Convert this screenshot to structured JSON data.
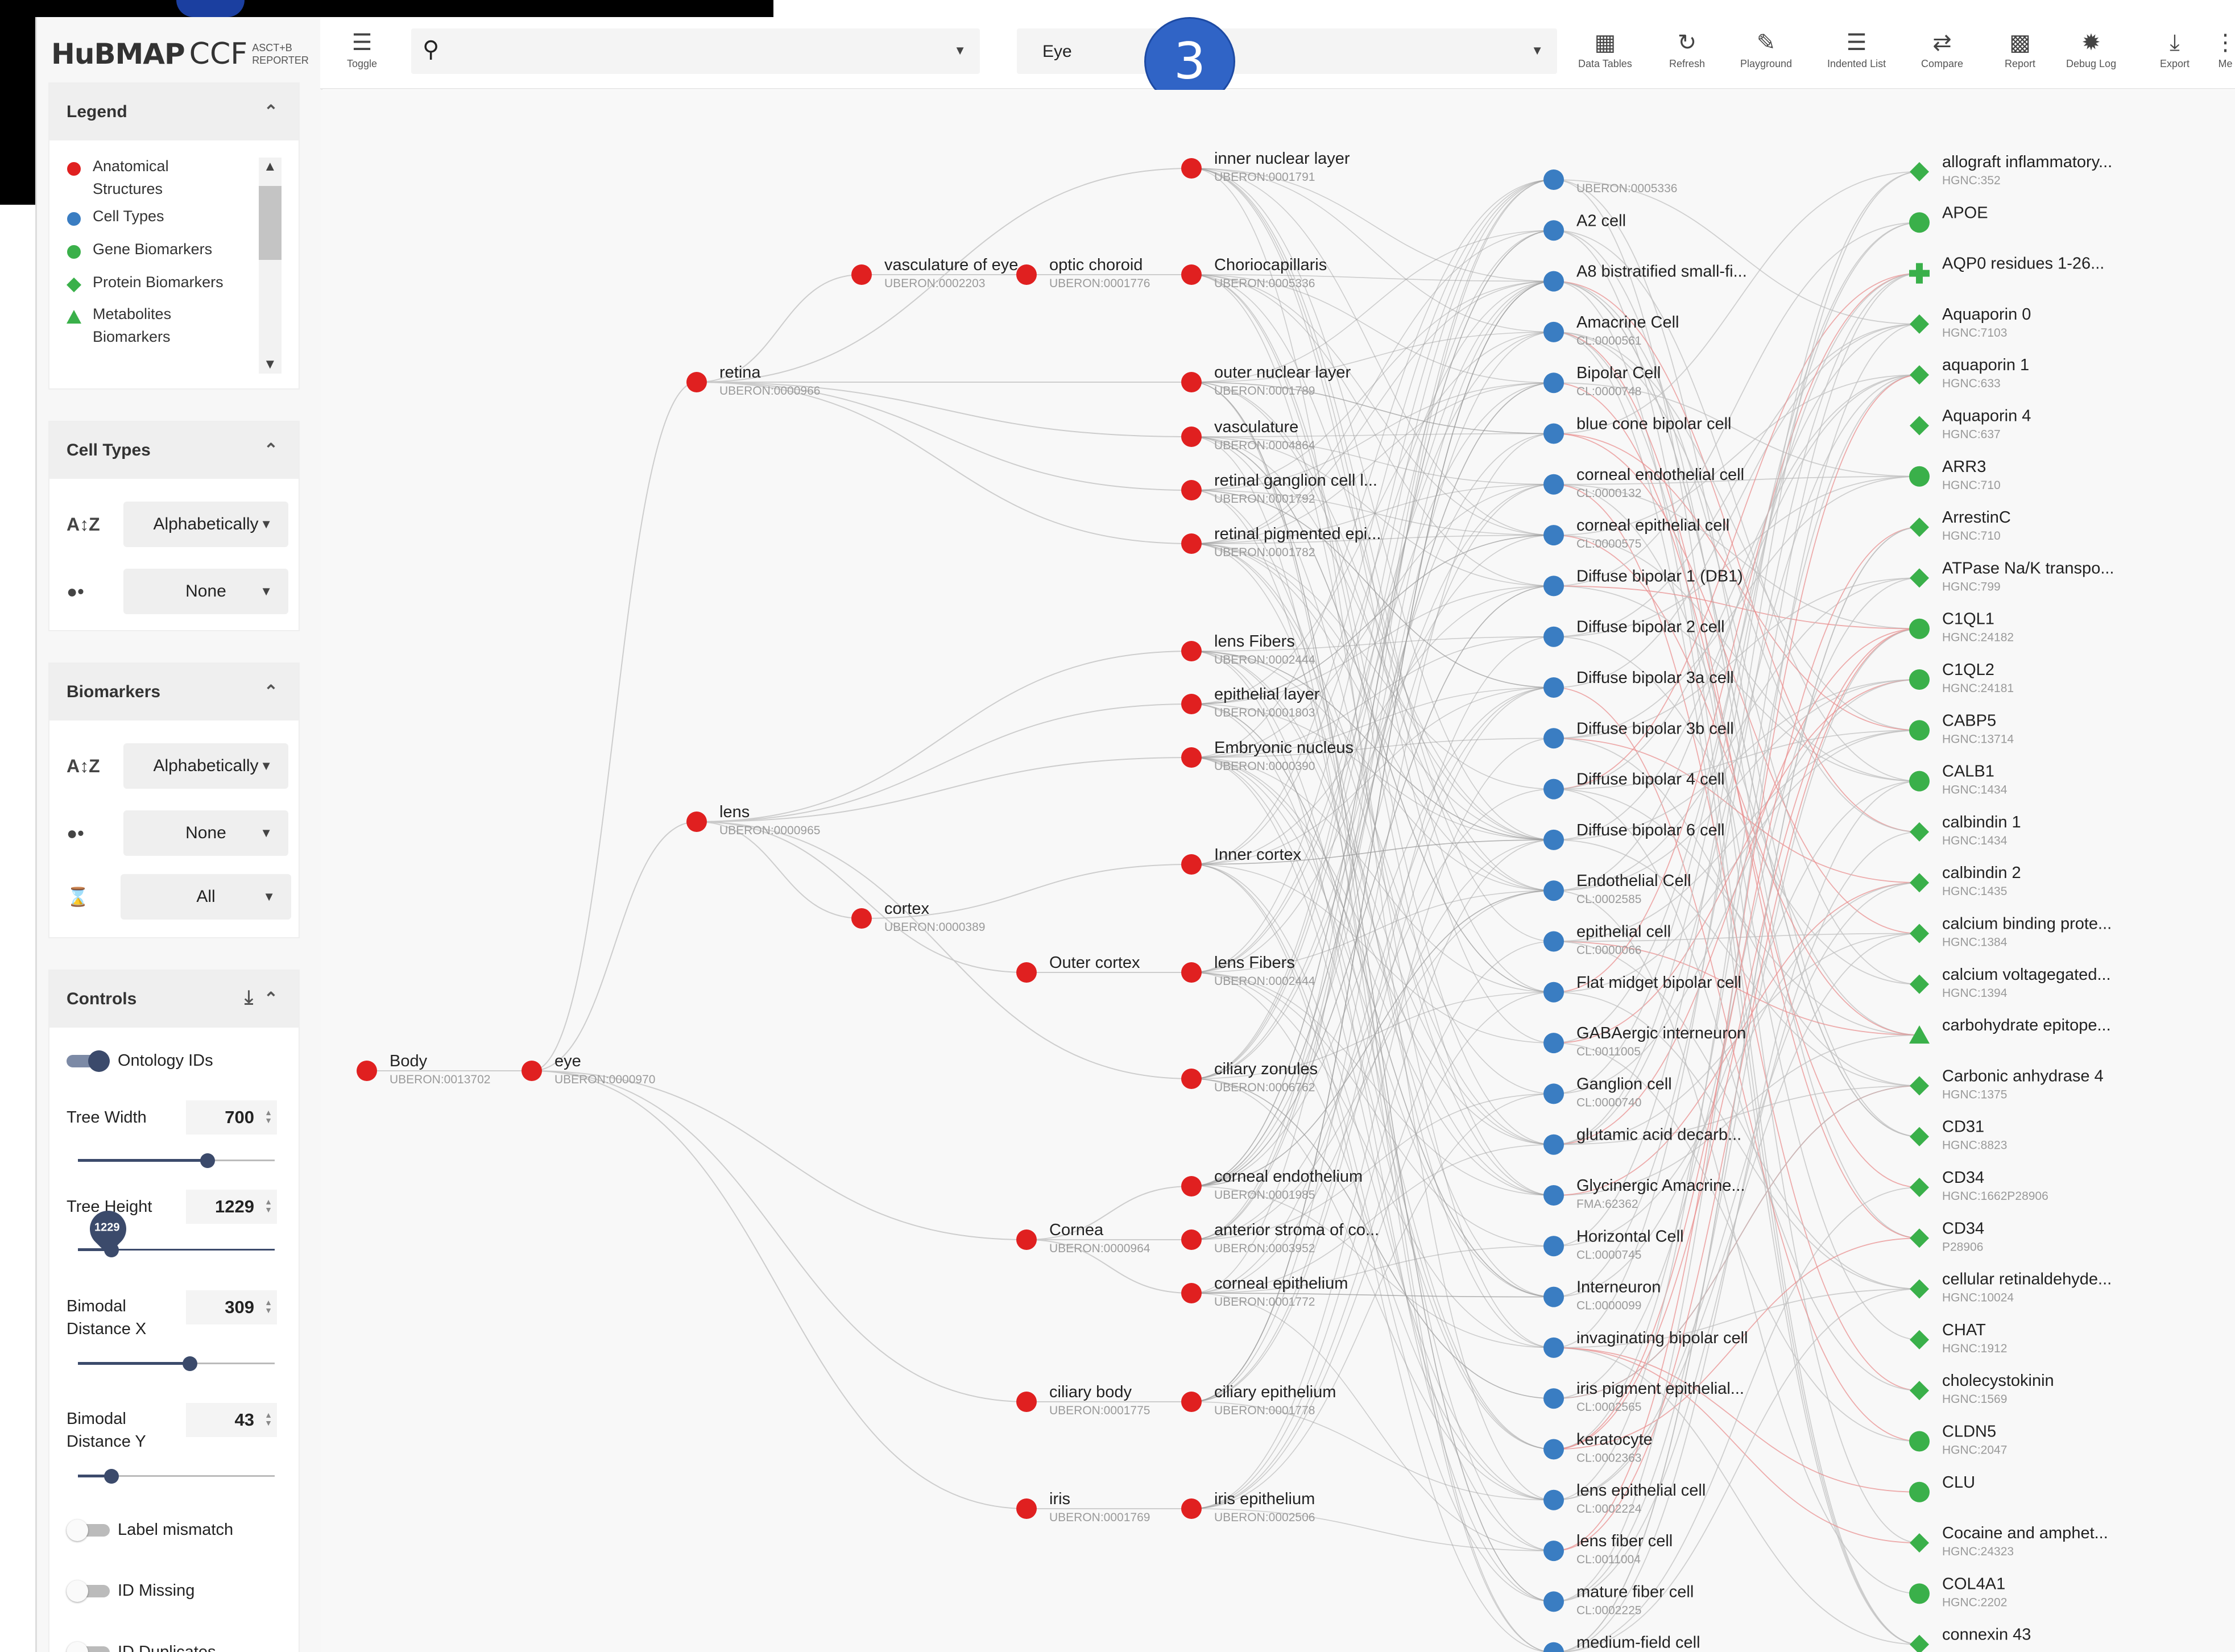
{
  "app": {
    "logo_hubmap": "HuBMAP",
    "logo_ccf": "CCF",
    "logo_sub1": "ASCT+B",
    "logo_sub2": "REPORTER",
    "step_number": "3"
  },
  "colors": {
    "anatomical": "#e02020",
    "cell": "#3a7dc2",
    "gene": "#3ab04a",
    "protein": "#3ab04a",
    "metabolite": "#3ab04a",
    "slider": "#3b4a6b"
  },
  "legend": {
    "title": "Legend",
    "items": [
      {
        "label1": "Anatomical",
        "label2": "Structures",
        "icon": "red-circle"
      },
      {
        "label1": "Cell Types",
        "label2": "",
        "icon": "blue-circle"
      },
      {
        "label1": "Gene Biomarkers",
        "label2": "",
        "icon": "green-circle"
      },
      {
        "label1": "Protein Biomarkers",
        "label2": "",
        "icon": "green-diamond"
      },
      {
        "label1": "Metabolites",
        "label2": "Biomarkers",
        "icon": "green-triangle"
      }
    ]
  },
  "cell_types_panel": {
    "title": "Cell Types",
    "sort_value": "Alphabetically",
    "size_value": "None"
  },
  "biomarkers_panel": {
    "title": "Biomarkers",
    "sort_value": "Alphabetically",
    "size_value": "None",
    "type_value": "All"
  },
  "controls": {
    "title": "Controls",
    "ontology_ids": {
      "label": "Ontology IDs",
      "on": true
    },
    "tree_width": {
      "label": "Tree Width",
      "value": "700",
      "fraction": 0.66
    },
    "tree_height": {
      "label": "Tree Height",
      "value": "1229",
      "fraction": 0.17,
      "badge": "1229"
    },
    "bimodal_x": {
      "label1": "Bimodal",
      "label2": "Distance X",
      "value": "309",
      "fraction": 0.57
    },
    "bimodal_y": {
      "label1": "Bimodal",
      "label2": "Distance Y",
      "value": "43",
      "fraction": 0.17
    },
    "label_mismatch": {
      "label": "Label mismatch",
      "on": false
    },
    "id_missing": {
      "label": "ID Missing",
      "on": false
    },
    "id_duplicates": {
      "label": "ID Duplicates",
      "on": false
    }
  },
  "toolbar": {
    "toggle_label": "Toggle",
    "search_value": "",
    "organ_value": "Eye",
    "buttons": [
      {
        "label": "Data Tables",
        "icon": "table-icon"
      },
      {
        "label": "Refresh",
        "icon": "refresh-icon"
      },
      {
        "label": "Playground",
        "icon": "pencil-icon"
      },
      {
        "label": "Indented List",
        "icon": "list-icon"
      },
      {
        "label": "Compare",
        "icon": "compare-icon"
      },
      {
        "label": "Report",
        "icon": "report-icon"
      },
      {
        "label": "Debug Log",
        "icon": "bug-icon"
      },
      {
        "label": "Export",
        "icon": "download-icon"
      },
      {
        "label": "Me",
        "icon": "more-icon"
      }
    ]
  },
  "graph": {
    "anatomical": [
      {
        "name": "Body",
        "id": "UBERON:0013702"
      },
      {
        "name": "eye",
        "id": "UBERON:0000970"
      },
      {
        "name": "retina",
        "id": "UBERON:0000966"
      },
      {
        "name": "lens",
        "id": "UBERON:0000965"
      },
      {
        "name": "vasculature of eye",
        "id": "UBERON:0002203"
      },
      {
        "name": "cortex",
        "id": "UBERON:0000389"
      },
      {
        "name": "optic choroid",
        "id": "UBERON:0001776"
      },
      {
        "name": "Outer cortex",
        "id": ""
      },
      {
        "name": "Cornea",
        "id": "UBERON:0000964"
      },
      {
        "name": "ciliary body",
        "id": "UBERON:0001775"
      },
      {
        "name": "iris",
        "id": "UBERON:0001769"
      },
      {
        "name": "inner nuclear layer",
        "id": "UBERON:0001791"
      },
      {
        "name": "Choriocapillaris",
        "id": "UBERON:0005336"
      },
      {
        "name": "outer nuclear layer",
        "id": "UBERON:0001789"
      },
      {
        "name": "vasculature",
        "id": "UBERON:0004864"
      },
      {
        "name": "retinal ganglion cell l...",
        "id": "UBERON:0001792"
      },
      {
        "name": "retinal pigmented epi...",
        "id": "UBERON:0001782"
      },
      {
        "name": "lens Fibers",
        "id": "UBERON:0002444"
      },
      {
        "name": "epithelial layer",
        "id": "UBERON:0001803"
      },
      {
        "name": "Embryonic nucleus",
        "id": "UBERON:0000390"
      },
      {
        "name": "Inner cortex",
        "id": ""
      },
      {
        "name": "lens Fibers",
        "id": "UBERON:0002444"
      },
      {
        "name": "ciliary zonules",
        "id": "UBERON:0006762"
      },
      {
        "name": "corneal endothelium",
        "id": "UBERON:0001985"
      },
      {
        "name": "anterior stroma of co...",
        "id": "UBERON:0003952"
      },
      {
        "name": "corneal epithelium",
        "id": "UBERON:0001772"
      },
      {
        "name": "ciliary epithelium",
        "id": "UBERON:0001778"
      },
      {
        "name": "iris epithelium",
        "id": "UBERON:0002506"
      }
    ],
    "cells": [
      {
        "name": "",
        "id": "UBERON:0005336"
      },
      {
        "name": "A2 cell",
        "id": ""
      },
      {
        "name": "A8 bistratified small-fi...",
        "id": ""
      },
      {
        "name": "Amacrine Cell",
        "id": "CL:0000561"
      },
      {
        "name": "Bipolar Cell",
        "id": "CL:0000748"
      },
      {
        "name": "blue cone bipolar cell",
        "id": ""
      },
      {
        "name": "corneal endothelial cell",
        "id": "CL:0000132"
      },
      {
        "name": "corneal epithelial cell",
        "id": "CL:0000575"
      },
      {
        "name": "Diffuse bipolar 1 (DB1)",
        "id": ""
      },
      {
        "name": "Diffuse bipolar 2 cell",
        "id": ""
      },
      {
        "name": "Diffuse bipolar 3a cell",
        "id": ""
      },
      {
        "name": "Diffuse bipolar 3b cell",
        "id": ""
      },
      {
        "name": "Diffuse bipolar 4 cell",
        "id": ""
      },
      {
        "name": "Diffuse bipolar 6 cell",
        "id": ""
      },
      {
        "name": "Endothelial Cell",
        "id": "CL:0002585"
      },
      {
        "name": "epithelial cell",
        "id": "CL:0000066"
      },
      {
        "name": "Flat midget bipolar cell",
        "id": ""
      },
      {
        "name": "GABAergic interneuron",
        "id": "CL:0011005"
      },
      {
        "name": "Ganglion cell",
        "id": "CL:0000740"
      },
      {
        "name": "glutamic acid decarb...",
        "id": ""
      },
      {
        "name": "Glycinergic Amacrine...",
        "id": "FMA:62362"
      },
      {
        "name": "Horizontal Cell",
        "id": "CL:0000745"
      },
      {
        "name": "Interneuron",
        "id": "CL:0000099"
      },
      {
        "name": "invaginating bipolar cell",
        "id": ""
      },
      {
        "name": "iris pigment epithelial...",
        "id": "CL:0002565"
      },
      {
        "name": "keratocyte",
        "id": "CL:0002363"
      },
      {
        "name": "lens epithelial cell",
        "id": "CL:0002224"
      },
      {
        "name": "lens fiber cell",
        "id": "CL:0011004"
      },
      {
        "name": "mature fiber cell",
        "id": "CL:0002225"
      },
      {
        "name": "medium-field cell",
        "id": ""
      }
    ],
    "biomarkers": [
      {
        "name": "allograft inflammatory...",
        "id": "HGNC:352",
        "shape": "diamond"
      },
      {
        "name": "APOE",
        "id": "",
        "shape": "circle"
      },
      {
        "name": "AQP0 residues 1-26...",
        "id": "",
        "shape": "plus"
      },
      {
        "name": "Aquaporin 0",
        "id": "HGNC:7103",
        "shape": "diamond"
      },
      {
        "name": "aquaporin 1",
        "id": "HGNC:633",
        "shape": "diamond"
      },
      {
        "name": "Aquaporin 4",
        "id": "HGNC:637",
        "shape": "diamond"
      },
      {
        "name": "ARR3",
        "id": "HGNC:710",
        "shape": "circle"
      },
      {
        "name": "ArrestinC",
        "id": "HGNC:710",
        "shape": "diamond"
      },
      {
        "name": "ATPase Na/K transpo...",
        "id": "HGNC:799",
        "shape": "diamond"
      },
      {
        "name": "C1QL1",
        "id": "HGNC:24182",
        "shape": "circle"
      },
      {
        "name": "C1QL2",
        "id": "HGNC:24181",
        "shape": "circle"
      },
      {
        "name": "CABP5",
        "id": "HGNC:13714",
        "shape": "circle"
      },
      {
        "name": "CALB1",
        "id": "HGNC:1434",
        "shape": "circle"
      },
      {
        "name": "calbindin 1",
        "id": "HGNC:1434",
        "shape": "diamond"
      },
      {
        "name": "calbindin 2",
        "id": "HGNC:1435",
        "shape": "diamond"
      },
      {
        "name": "calcium binding prote...",
        "id": "HGNC:1384",
        "shape": "diamond"
      },
      {
        "name": "calcium voltagegated...",
        "id": "HGNC:1394",
        "shape": "diamond"
      },
      {
        "name": "carbohydrate epitope...",
        "id": "",
        "shape": "triangle"
      },
      {
        "name": "Carbonic anhydrase 4",
        "id": "HGNC:1375",
        "shape": "diamond"
      },
      {
        "name": "CD31",
        "id": "HGNC:8823",
        "shape": "diamond"
      },
      {
        "name": "CD34",
        "id": "HGNC:1662P28906",
        "shape": "diamond"
      },
      {
        "name": "CD34",
        "id": "P28906",
        "shape": "diamond"
      },
      {
        "name": "cellular retinaldehyde...",
        "id": "HGNC:10024",
        "shape": "diamond"
      },
      {
        "name": "CHAT",
        "id": "HGNC:1912",
        "shape": "diamond"
      },
      {
        "name": "cholecystokinin",
        "id": "HGNC:1569",
        "shape": "diamond"
      },
      {
        "name": "CLDN5",
        "id": "HGNC:2047",
        "shape": "circle"
      },
      {
        "name": "CLU",
        "id": "",
        "shape": "circle"
      },
      {
        "name": "Cocaine and amphet...",
        "id": "HGNC:24323",
        "shape": "diamond"
      },
      {
        "name": "COL4A1",
        "id": "HGNC:2202",
        "shape": "circle"
      },
      {
        "name": "connexin 43",
        "id": "",
        "shape": "diamond"
      }
    ]
  }
}
